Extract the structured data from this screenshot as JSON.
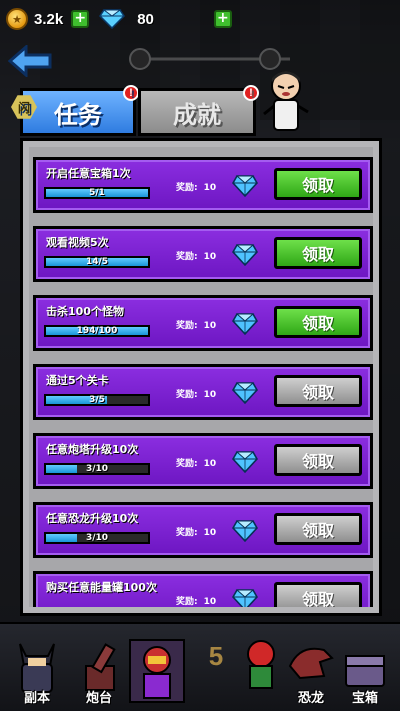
{
  "currency": {
    "gold": "3.2k",
    "gems": "80",
    "plus_symbol": "+"
  },
  "tabs": {
    "active_label": "任务",
    "inactive_label": "成就",
    "badge": "!",
    "hex_label": "闪"
  },
  "quests": [
    {
      "title": "开启任意宝箱1次",
      "progress_text": "5/1",
      "progress": 1.0,
      "reward_label": "奖励:",
      "reward_value": "10",
      "button_label": "领取",
      "state": "ready"
    },
    {
      "title": "观看视频5次",
      "progress_text": "14/5",
      "progress": 1.0,
      "reward_label": "奖励:",
      "reward_value": "10",
      "button_label": "领取",
      "state": "ready"
    },
    {
      "title": "击杀100个怪物",
      "progress_text": "194/100",
      "progress": 1.0,
      "reward_label": "奖励:",
      "reward_value": "10",
      "button_label": "领取",
      "state": "ready"
    },
    {
      "title": "通过5个关卡",
      "progress_text": "3/5",
      "progress": 0.6,
      "reward_label": "奖励:",
      "reward_value": "10",
      "button_label": "领取",
      "state": "locked"
    },
    {
      "title": "任意炮塔升级10次",
      "progress_text": "3/10",
      "progress": 0.3,
      "reward_label": "奖励:",
      "reward_value": "10",
      "button_label": "领取",
      "state": "locked"
    },
    {
      "title": "任意恐龙升级10次",
      "progress_text": "3/10",
      "progress": 0.3,
      "reward_label": "奖励:",
      "reward_value": "10",
      "button_label": "领取",
      "state": "locked"
    },
    {
      "title": "购买任意能量罐100次",
      "progress_text": "",
      "progress": 0.0,
      "reward_label": "奖励:",
      "reward_value": "10",
      "button_label": "领取",
      "state": "locked"
    }
  ],
  "bottom_bar": {
    "items": [
      "副本",
      "炮台",
      "",
      "",
      "恐龙",
      "宝箱"
    ],
    "center_level": "5"
  },
  "colors": {
    "quest_purple": "#7a20d0",
    "ready_green": "#3fbf2e",
    "locked_gray": "#a0a0a0",
    "tab_blue": "#3f8ae8",
    "progress_blue": "#2aa7e8"
  }
}
